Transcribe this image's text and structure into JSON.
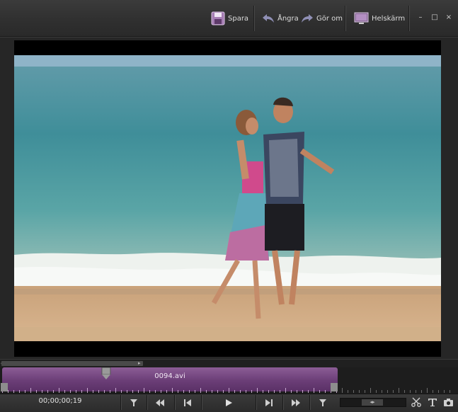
{
  "toolbar": {
    "save_label": "Spara",
    "undo_label": "Ångra",
    "redo_label": "Gör om",
    "fullscreen_label": "Helskärm"
  },
  "window_controls": {
    "minimize": "–",
    "maximize": "□",
    "close": "×"
  },
  "timeline": {
    "clip_name": "0094.avi",
    "playhead_position_fraction": 0.31
  },
  "transport": {
    "timecode": "00;00;00;19"
  },
  "colors": {
    "clip_purple": "#7a4b86",
    "background": "#2c2c2c",
    "accent_icon": "#b98cc7"
  },
  "icons": [
    "save-icon",
    "undo-icon",
    "redo-icon",
    "fullscreen-icon",
    "mark-in-icon",
    "rewind-icon",
    "step-back-icon",
    "play-icon",
    "step-forward-icon",
    "fast-forward-icon",
    "mark-out-icon",
    "scissors-icon",
    "text-icon",
    "camera-icon"
  ]
}
